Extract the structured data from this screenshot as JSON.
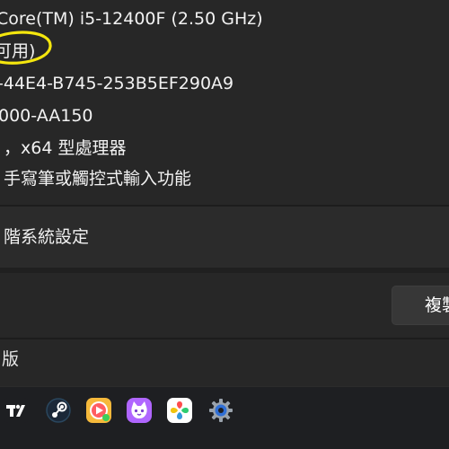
{
  "device_specs": {
    "processor": "Core(TM) i5-12400F (2.50 GHz)",
    "ram_note": "可用)",
    "device_id_fragment": "-44E4-B745-253B5EF290A9",
    "product_id_fragment": "000-AA150",
    "system_type": "，x64 型處理器",
    "pen_touch": "手寫筆或觸控式輸入功能"
  },
  "advanced_settings": {
    "label": "階系統設定"
  },
  "windows_spec": {
    "copy_button_label": "複製",
    "edition_fragment": "版"
  },
  "colors": {
    "background": "#202020",
    "card": "#272727",
    "highlight_marker": "#f4e60e"
  },
  "taskbar": {
    "apps": [
      "tradingview-icon",
      "steam-icon",
      "video-player-icon",
      "cat-app-icon",
      "photo-gallery-icon",
      "settings-gear-icon"
    ]
  }
}
